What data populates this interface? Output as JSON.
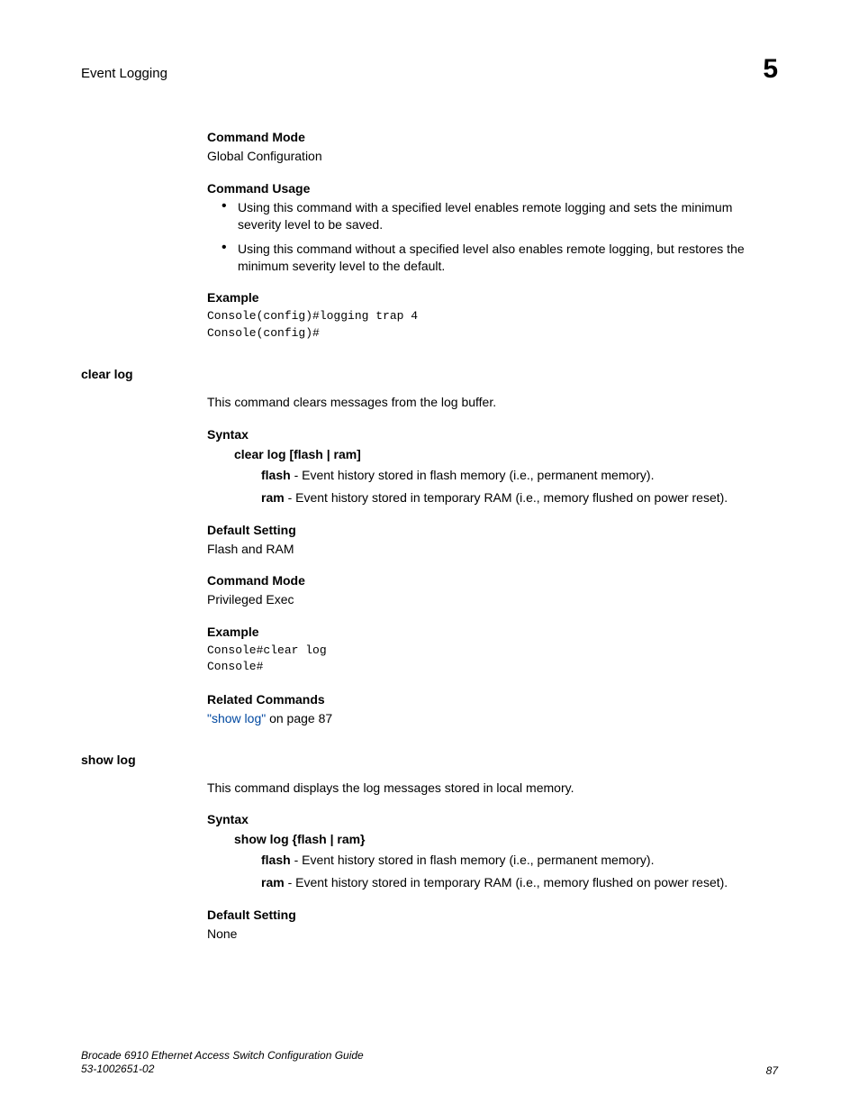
{
  "header": {
    "section_title": "Event Logging",
    "chapter_num": "5"
  },
  "section1": {
    "h_command_mode": "Command Mode",
    "command_mode_text": "Global Configuration",
    "h_command_usage": "Command Usage",
    "usage_bullet1": "Using this command with a specified level enables remote logging and sets the minimum severity level to be saved.",
    "usage_bullet2": "Using this command without a specified level also enables remote logging, but restores the minimum severity level to the default.",
    "h_example": "Example",
    "example_code": "Console(config)#logging trap 4\nConsole(config)#"
  },
  "clearlog": {
    "sidebar": "clear log",
    "intro": "This command clears messages from the log buffer.",
    "h_syntax": "Syntax",
    "syntax_cmd": "clear log [flash | ram]",
    "param_flash_name": "flash",
    "param_flash_desc": " - Event history stored in flash memory (i.e., permanent memory).",
    "param_ram_name": "ram",
    "param_ram_desc": " - Event history stored in temporary RAM (i.e., memory flushed on power reset).",
    "h_default": "Default Setting",
    "default_text": "Flash and RAM",
    "h_command_mode": "Command Mode",
    "command_mode_text": "Privileged Exec",
    "h_example": "Example",
    "example_code": "Console#clear log\nConsole#",
    "h_related": "Related Commands",
    "related_link": "\"show log\"",
    "related_after": " on page 87"
  },
  "showlog": {
    "sidebar": "show log",
    "intro": "This command displays the log messages stored in local memory.",
    "h_syntax": "Syntax",
    "syntax_cmd": "show log {flash | ram}",
    "param_flash_name": "flash",
    "param_flash_desc": " - Event history stored in flash memory (i.e., permanent memory).",
    "param_ram_name": "ram",
    "param_ram_desc": " - Event history stored in temporary RAM (i.e., memory flushed on power reset).",
    "h_default": "Default Setting",
    "default_text": "None"
  },
  "footer": {
    "guide_title": "Brocade 6910 Ethernet Access Switch Configuration Guide",
    "doc_num": "53-1002651-02",
    "page_num": "87"
  }
}
